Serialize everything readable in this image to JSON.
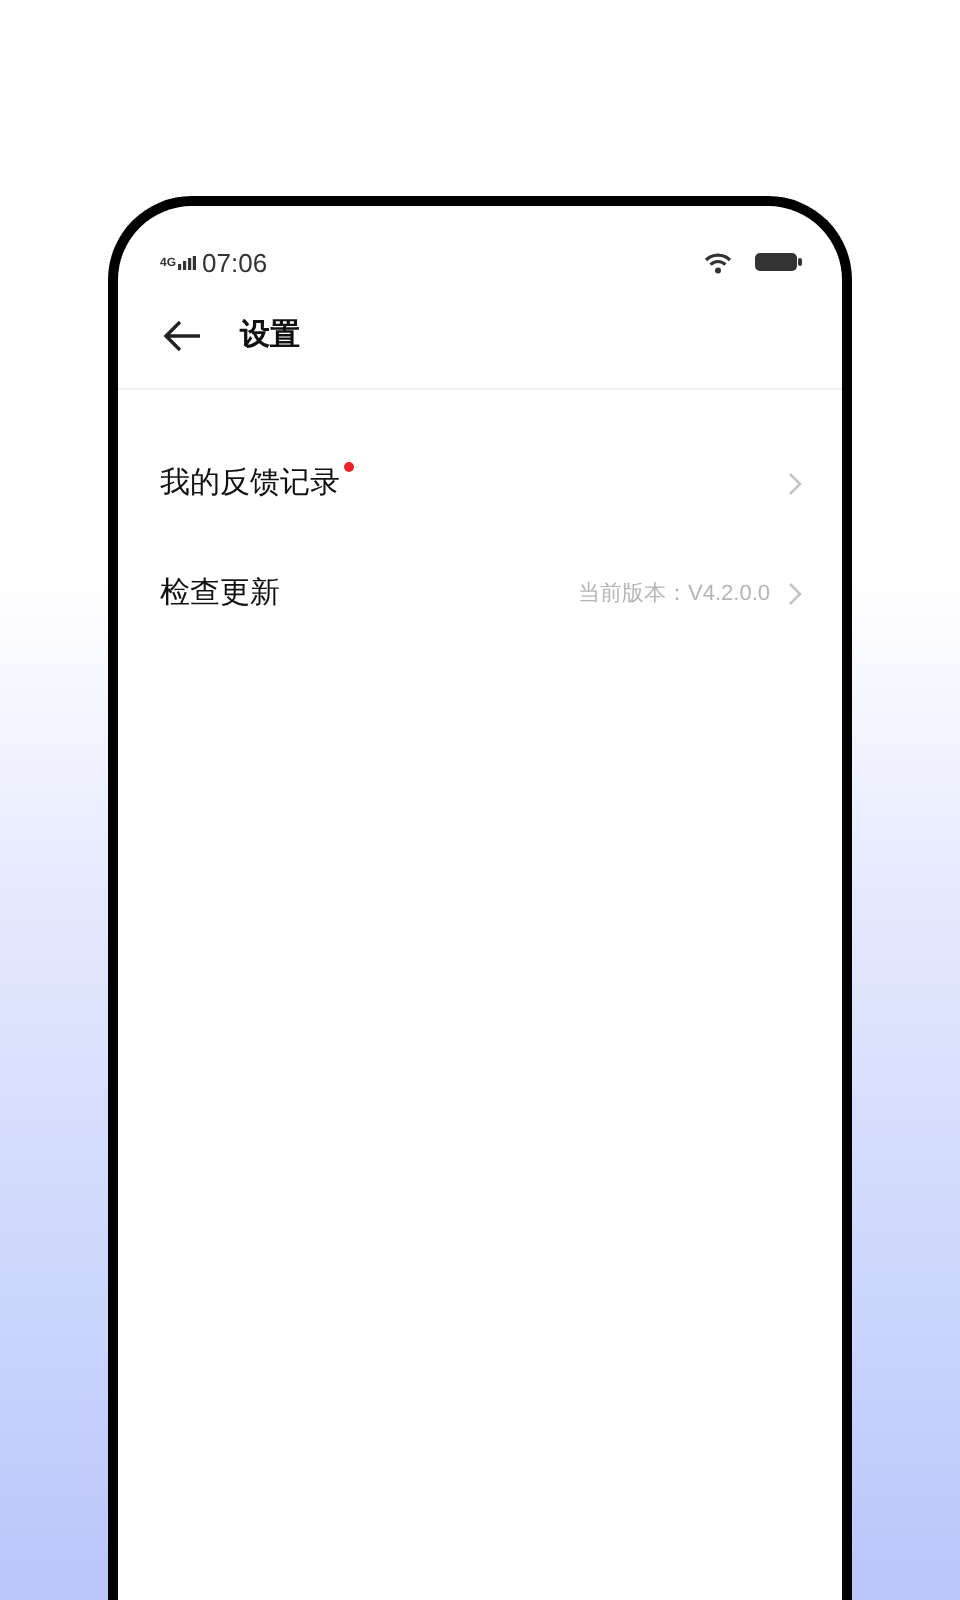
{
  "status_bar": {
    "network": "4G",
    "time": "07:06"
  },
  "header": {
    "title": "设置"
  },
  "items": [
    {
      "label": "我的反馈记录",
      "unread_dot": true
    },
    {
      "label": "检查更新",
      "value": "当前版本：V4.2.0.0"
    }
  ]
}
